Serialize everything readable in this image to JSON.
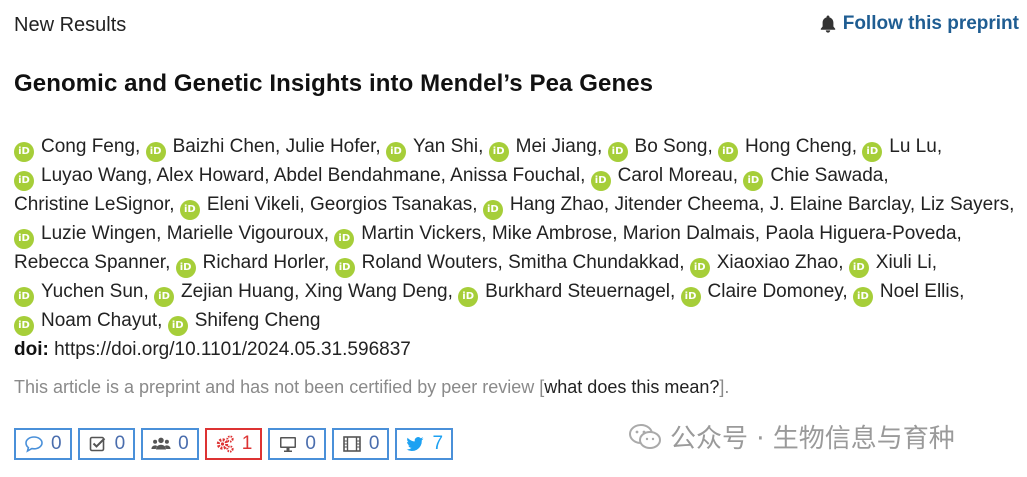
{
  "header": {
    "label": "New Results",
    "follow_label": "Follow this preprint"
  },
  "article": {
    "title": "Genomic and Genetic Insights into Mendel’s Pea Genes",
    "authors": [
      {
        "name": "Cong Feng",
        "orcid": true
      },
      {
        "name": "Baizhi Chen",
        "orcid": true
      },
      {
        "name": "Julie Hofer",
        "orcid": false
      },
      {
        "name": "Yan Shi",
        "orcid": true
      },
      {
        "name": "Mei Jiang",
        "orcid": true
      },
      {
        "name": "Bo Song",
        "orcid": true
      },
      {
        "name": "Hong Cheng",
        "orcid": true
      },
      {
        "name": "Lu Lu",
        "orcid": true
      },
      {
        "name": "Luyao Wang",
        "orcid": true
      },
      {
        "name": "Alex Howard",
        "orcid": false
      },
      {
        "name": "Abdel Bendahmane",
        "orcid": false
      },
      {
        "name": "Anissa Fouchal",
        "orcid": false
      },
      {
        "name": "Carol Moreau",
        "orcid": true
      },
      {
        "name": "Chie Sawada",
        "orcid": true
      },
      {
        "name": "Christine LeSignor",
        "orcid": false
      },
      {
        "name": "Eleni Vikeli",
        "orcid": true
      },
      {
        "name": "Georgios Tsanakas",
        "orcid": false
      },
      {
        "name": "Hang Zhao",
        "orcid": true
      },
      {
        "name": "Jitender Cheema",
        "orcid": false
      },
      {
        "name": "J. Elaine Barclay",
        "orcid": false
      },
      {
        "name": "Liz Sayers",
        "orcid": false
      },
      {
        "name": "Luzie Wingen",
        "orcid": true
      },
      {
        "name": "Marielle Vigouroux",
        "orcid": false
      },
      {
        "name": "Martin Vickers",
        "orcid": true
      },
      {
        "name": "Mike Ambrose",
        "orcid": false
      },
      {
        "name": "Marion Dalmais",
        "orcid": false
      },
      {
        "name": "Paola Higuera-Poveda",
        "orcid": false
      },
      {
        "name": "Rebecca Spanner",
        "orcid": false
      },
      {
        "name": "Richard Horler",
        "orcid": true
      },
      {
        "name": "Roland Wouters",
        "orcid": true
      },
      {
        "name": "Smitha Chundakkad",
        "orcid": false
      },
      {
        "name": "Xiaoxiao Zhao",
        "orcid": true
      },
      {
        "name": "Xiuli Li",
        "orcid": true
      },
      {
        "name": "Yuchen Sun",
        "orcid": true
      },
      {
        "name": "Zejian Huang",
        "orcid": true
      },
      {
        "name": "Xing Wang Deng",
        "orcid": false
      },
      {
        "name": "Burkhard Steuernagel",
        "orcid": true
      },
      {
        "name": "Claire Domoney",
        "orcid": true
      },
      {
        "name": "Noel Ellis",
        "orcid": true
      },
      {
        "name": "Noam Chayut",
        "orcid": true
      },
      {
        "name": "Shifeng Cheng",
        "orcid": true
      }
    ],
    "orcid_badge": "iD",
    "doi_label": "doi:",
    "doi_value": "https://doi.org/10.1101/2024.05.31.596837",
    "disclaimer_text": "This article is a preprint and has not been certified by peer review [",
    "disclaimer_link": "what does this mean?",
    "disclaimer_end": "]."
  },
  "metrics": [
    {
      "icon": "comment-icon",
      "value": "0",
      "color": "#4a90d9"
    },
    {
      "icon": "check-icon",
      "value": "0",
      "color": "#4a90d9"
    },
    {
      "icon": "users-icon",
      "value": "0",
      "color": "#4a90d9"
    },
    {
      "icon": "gears-icon",
      "value": "1",
      "color": "#d33333"
    },
    {
      "icon": "monitor-icon",
      "value": "0",
      "color": "#4a90d9"
    },
    {
      "icon": "film-icon",
      "value": "0",
      "color": "#4a90d9"
    },
    {
      "icon": "twitter-icon",
      "value": "7",
      "color": "#1da1f2"
    }
  ],
  "watermark": {
    "text": "公众号 · 生物信息与育种"
  },
  "colors": {
    "link_blue": "#1f5d92",
    "orcid_green": "#a6ce39",
    "border_blue": "#4a90d9",
    "alert_red": "#d33333"
  }
}
